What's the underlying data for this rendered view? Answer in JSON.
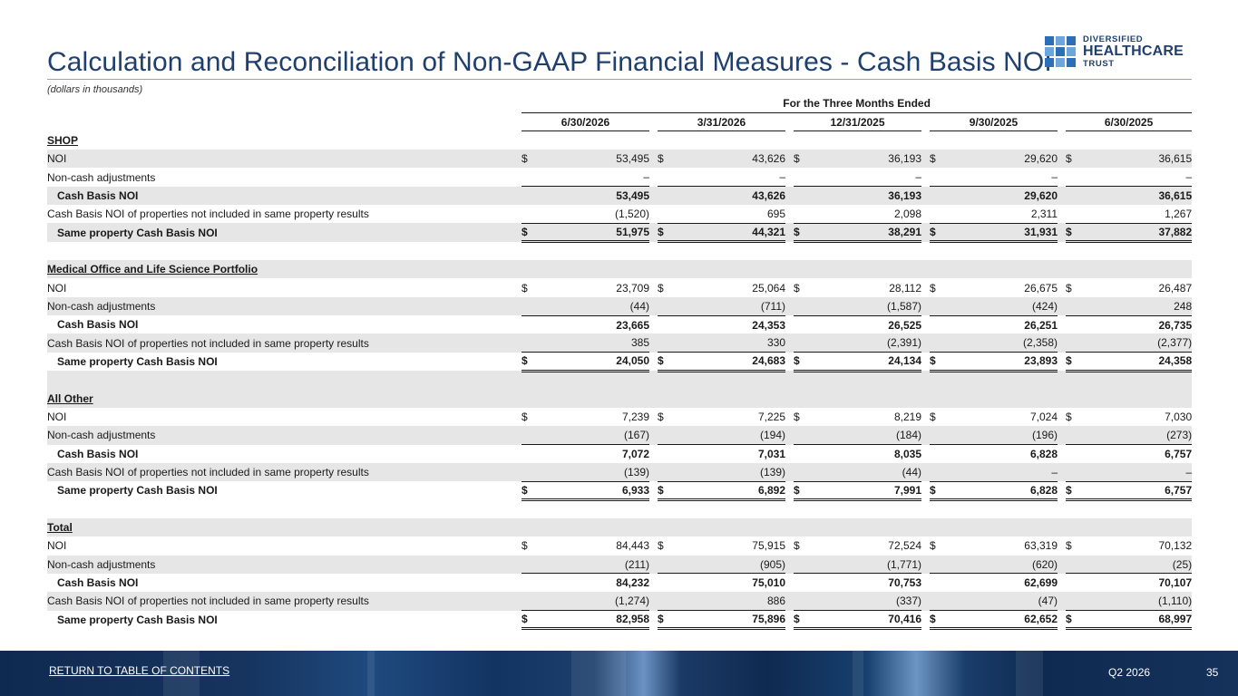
{
  "header": {
    "title": "Calculation and Reconciliation of Non-GAAP Financial Measures - Cash Basis NOI",
    "subtitle": "(dollars in thousands)"
  },
  "logo": {
    "line1": "DIVERSIFIED",
    "line2": "HEALTHCARE",
    "line3": "TRUST"
  },
  "table": {
    "period_header": "For the Three Months Ended",
    "periods": [
      "6/30/2026",
      "3/31/2026",
      "12/31/2025",
      "9/30/2025",
      "6/30/2025"
    ],
    "sections": [
      {
        "name": "SHOP",
        "rows": [
          {
            "label": "NOI",
            "values": [
              "53,495",
              "43,626",
              "36,193",
              "29,620",
              "36,615"
            ]
          },
          {
            "label": "Non-cash adjustments",
            "values": [
              "–",
              "–",
              "–",
              "–",
              "–"
            ]
          },
          {
            "label": "Cash Basis NOI",
            "values": [
              "53,495",
              "43,626",
              "36,193",
              "29,620",
              "36,615"
            ]
          },
          {
            "label": "Cash Basis NOI of properties not included in same property results",
            "values": [
              "(1,520)",
              "695",
              "2,098",
              "2,311",
              "1,267"
            ]
          },
          {
            "label": "Same property Cash Basis NOI",
            "values": [
              "51,975",
              "44,321",
              "38,291",
              "31,931",
              "37,882"
            ]
          }
        ]
      },
      {
        "name": "Medical Office and Life Science Portfolio",
        "rows": [
          {
            "label": "NOI",
            "values": [
              "23,709",
              "25,064",
              "28,112",
              "26,675",
              "26,487"
            ]
          },
          {
            "label": "Non-cash adjustments",
            "values": [
              "(44)",
              "(711)",
              "(1,587)",
              "(424)",
              "248"
            ]
          },
          {
            "label": "Cash Basis NOI",
            "values": [
              "23,665",
              "24,353",
              "26,525",
              "26,251",
              "26,735"
            ]
          },
          {
            "label": "Cash Basis NOI of properties not included in same property results",
            "values": [
              "385",
              "330",
              "(2,391)",
              "(2,358)",
              "(2,377)"
            ]
          },
          {
            "label": "Same property Cash Basis NOI",
            "values": [
              "24,050",
              "24,683",
              "24,134",
              "23,893",
              "24,358"
            ]
          }
        ]
      },
      {
        "name": "All Other",
        "rows": [
          {
            "label": "NOI",
            "values": [
              "7,239",
              "7,225",
              "8,219",
              "7,024",
              "7,030"
            ]
          },
          {
            "label": "Non-cash adjustments",
            "values": [
              "(167)",
              "(194)",
              "(184)",
              "(196)",
              "(273)"
            ]
          },
          {
            "label": "Cash Basis NOI",
            "values": [
              "7,072",
              "7,031",
              "8,035",
              "6,828",
              "6,757"
            ]
          },
          {
            "label": "Cash Basis NOI of properties not included in same property results",
            "values": [
              "(139)",
              "(139)",
              "(44)",
              "–",
              "–"
            ]
          },
          {
            "label": "Same property Cash Basis NOI",
            "values": [
              "6,933",
              "6,892",
              "7,991",
              "6,828",
              "6,757"
            ]
          }
        ]
      },
      {
        "name": "Total",
        "rows": [
          {
            "label": "NOI",
            "values": [
              "84,443",
              "75,915",
              "72,524",
              "63,319",
              "70,132"
            ]
          },
          {
            "label": "Non-cash adjustments",
            "values": [
              "(211)",
              "(905)",
              "(1,771)",
              "(620)",
              "(25)"
            ]
          },
          {
            "label": "Cash Basis NOI",
            "values": [
              "84,232",
              "75,010",
              "70,753",
              "62,699",
              "70,107"
            ]
          },
          {
            "label": "Cash Basis NOI of properties not included in same property results",
            "values": [
              "(1,274)",
              "886",
              "(337)",
              "(47)",
              "(1,110)"
            ]
          },
          {
            "label": "Same property Cash Basis NOI",
            "values": [
              "82,958",
              "75,896",
              "70,416",
              "62,652",
              "68,997"
            ]
          }
        ]
      }
    ]
  },
  "footer": {
    "link_label": "RETURN TO TABLE OF CONTENTS",
    "quarter": "Q2 2026",
    "page_number": "35"
  }
}
